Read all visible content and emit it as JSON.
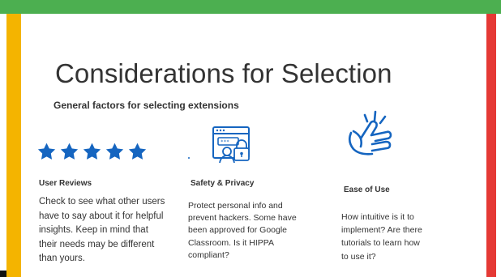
{
  "title": "Considerations for Selection",
  "subtitle": "General factors for selecting extensions",
  "colors": {
    "top_bar": "#4caf50",
    "left_bar": "#f4b400",
    "right_bar": "#e53935",
    "icon_blue": "#1565c0",
    "text": "#333333"
  },
  "columns": [
    {
      "heading": "User Reviews",
      "icon": "five-star-rating-icon",
      "rating": 5,
      "text": "Check to see what  other users\nhave to say about it for helpful\ninsights. Keep in mind that\ntheir needs may be different\nthan yours."
    },
    {
      "heading": "Safety & Privacy",
      "icon": "browser-security-lock-icon",
      "text": "Protect personal info and\nprevent hackers. Some have\nbeen approved for Google\nClassroom. Is it HIPPA\ncompliant?"
    },
    {
      "heading": "Ease of Use",
      "icon": "snapping-hand-icon",
      "text": "How intuitive is it to\nimplement? Are there\ntutorials to learn how\nto use it?"
    }
  ]
}
